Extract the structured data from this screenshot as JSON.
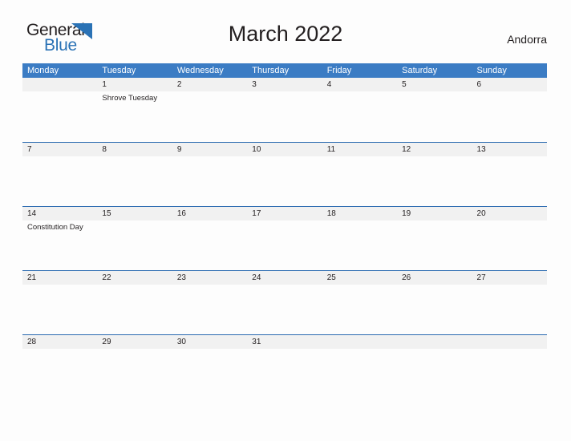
{
  "brand": {
    "name_part1": "General",
    "name_part2": "Blue",
    "mark": "triangle-logo",
    "accent_color": "#2a72b5"
  },
  "header": {
    "title": "March 2022",
    "location": "Andorra"
  },
  "theme": {
    "header_blue": "#3b7cc4",
    "rule_blue": "#2a6ab0",
    "date_band": "#f1f1f1",
    "page_background": "#fdfdfd",
    "text": "#231f20"
  },
  "calendar": {
    "month": "March",
    "year": "2022",
    "weekday_headers": [
      "Monday",
      "Tuesday",
      "Wednesday",
      "Thursday",
      "Friday",
      "Saturday",
      "Sunday"
    ],
    "weeks": [
      {
        "days": [
          {
            "num": "",
            "events": []
          },
          {
            "num": "1",
            "events": [
              "Shrove Tuesday"
            ]
          },
          {
            "num": "2",
            "events": []
          },
          {
            "num": "3",
            "events": []
          },
          {
            "num": "4",
            "events": []
          },
          {
            "num": "5",
            "events": []
          },
          {
            "num": "6",
            "events": []
          }
        ]
      },
      {
        "days": [
          {
            "num": "7",
            "events": []
          },
          {
            "num": "8",
            "events": []
          },
          {
            "num": "9",
            "events": []
          },
          {
            "num": "10",
            "events": []
          },
          {
            "num": "11",
            "events": []
          },
          {
            "num": "12",
            "events": []
          },
          {
            "num": "13",
            "events": []
          }
        ]
      },
      {
        "days": [
          {
            "num": "14",
            "events": [
              "Constitution Day"
            ]
          },
          {
            "num": "15",
            "events": []
          },
          {
            "num": "16",
            "events": []
          },
          {
            "num": "17",
            "events": []
          },
          {
            "num": "18",
            "events": []
          },
          {
            "num": "19",
            "events": []
          },
          {
            "num": "20",
            "events": []
          }
        ]
      },
      {
        "days": [
          {
            "num": "21",
            "events": []
          },
          {
            "num": "22",
            "events": []
          },
          {
            "num": "23",
            "events": []
          },
          {
            "num": "24",
            "events": []
          },
          {
            "num": "25",
            "events": []
          },
          {
            "num": "26",
            "events": []
          },
          {
            "num": "27",
            "events": []
          }
        ]
      },
      {
        "days": [
          {
            "num": "28",
            "events": []
          },
          {
            "num": "29",
            "events": []
          },
          {
            "num": "30",
            "events": []
          },
          {
            "num": "31",
            "events": []
          },
          {
            "num": "",
            "events": []
          },
          {
            "num": "",
            "events": []
          },
          {
            "num": "",
            "events": []
          }
        ]
      }
    ]
  }
}
